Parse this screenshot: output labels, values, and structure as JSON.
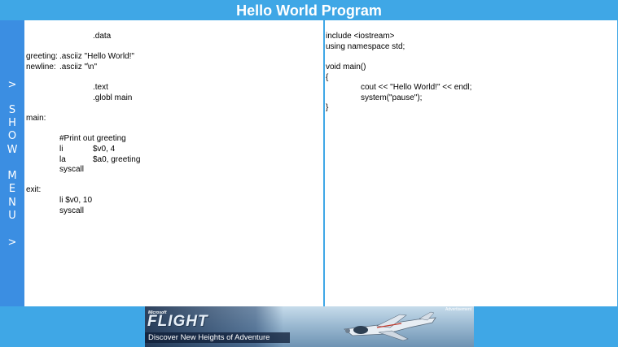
{
  "app": {
    "title": "Hello World Program"
  },
  "side_menu": {
    "chars": [
      ">",
      "S",
      "H",
      "O",
      "W",
      "M",
      "E",
      "N",
      "U",
      ">"
    ]
  },
  "assembly_code": {
    "lines": [
      {
        "label": "",
        "op": ".data",
        "args": ""
      },
      {
        "label": "greeting:",
        "op": ".asciiz \"Hello World!\"",
        "args": ""
      },
      {
        "label": "newline:",
        "op": ".asciiz \"\\n\"",
        "args": ""
      },
      {
        "label": "",
        "op": ".text",
        "args": ""
      },
      {
        "label": "",
        "op": ".globl main",
        "args": ""
      },
      {
        "label": "main:",
        "op": "",
        "args": ""
      },
      {
        "label": "",
        "op": "#Print out greeting",
        "args": ""
      },
      {
        "label": "",
        "op": "li",
        "args": "$v0, 4"
      },
      {
        "label": "",
        "op": "la",
        "args": "$a0, greeting"
      },
      {
        "label": "",
        "op": "syscall",
        "args": ""
      },
      {
        "label": "exit:",
        "op": "",
        "args": ""
      },
      {
        "label": "",
        "op": "li $v0, 10",
        "args": ""
      },
      {
        "label": "",
        "op": "syscall",
        "args": ""
      }
    ]
  },
  "cpp_code": {
    "lines": [
      "include <iostream>",
      "using namespace std;",
      "void main()",
      "{",
      "cout << \"Hello World!\" << endl;",
      "system(\"pause\");",
      "}"
    ]
  },
  "ad": {
    "brand": "Microsoft",
    "product": "FLIGHT",
    "tagline": "Discover New Heights of Adventure",
    "label": "Advertisement"
  },
  "colors": {
    "header_bg": "#3fa7e6",
    "side_menu_bg": "#3b8ee2",
    "pane_bg": "#ffffff"
  }
}
